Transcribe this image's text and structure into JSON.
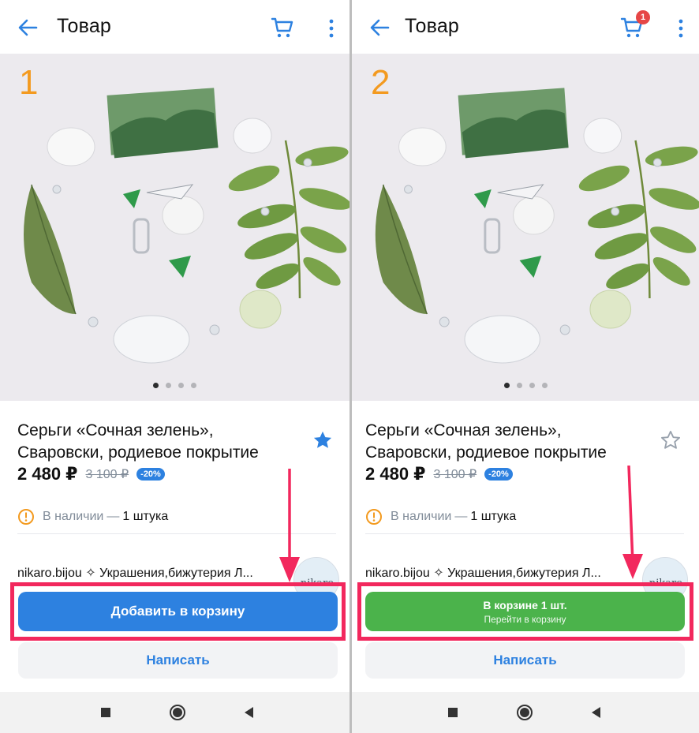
{
  "colors": {
    "accent_blue": "#2d81e0",
    "success_green": "#4bb34b",
    "highlight_red": "#f2285d",
    "step_orange": "#f39a1f",
    "badge_red": "#e64646"
  },
  "panels": [
    {
      "step": "1",
      "header": {
        "title": "Товар",
        "cart_icon": "cart-icon",
        "cart_badge": ""
      },
      "product": {
        "title": "Серьги «Сочная зелень», Сваровски, родиевое покрытие",
        "price": "2 480 ₽",
        "old_price": "3 100 ₽",
        "discount": "-20%",
        "favorite": true
      },
      "gallery": {
        "total": 4,
        "active": 1
      },
      "stock": {
        "label": "В наличии",
        "separator": "—",
        "value": "1 штука"
      },
      "shop": {
        "name": "nikaro.bijou ✧ Украшения,бижутерия Л..."
      },
      "cta": {
        "main": "Добавить в корзину",
        "sub": ""
      },
      "write_button": "Написать"
    },
    {
      "step": "2",
      "header": {
        "title": "Товар",
        "cart_icon": "cart-icon",
        "cart_badge": "1"
      },
      "product": {
        "title": "Серьги «Сочная зелень», Сваровски, родиевое покрытие",
        "price": "2 480 ₽",
        "old_price": "3 100 ₽",
        "discount": "-20%",
        "favorite": false
      },
      "gallery": {
        "total": 4,
        "active": 1
      },
      "stock": {
        "label": "В наличии",
        "separator": "—",
        "value": "1 штука"
      },
      "shop": {
        "name": "nikaro.bijou ✧ Украшения,бижутерия Л..."
      },
      "cta": {
        "main": "В корзине 1 шт.",
        "sub": "Перейти в корзину"
      },
      "write_button": "Написать"
    }
  ],
  "avatar_text": "nikaro",
  "navbar": {
    "icons": [
      "square-icon",
      "circle-icon",
      "triangle-back-icon"
    ]
  }
}
